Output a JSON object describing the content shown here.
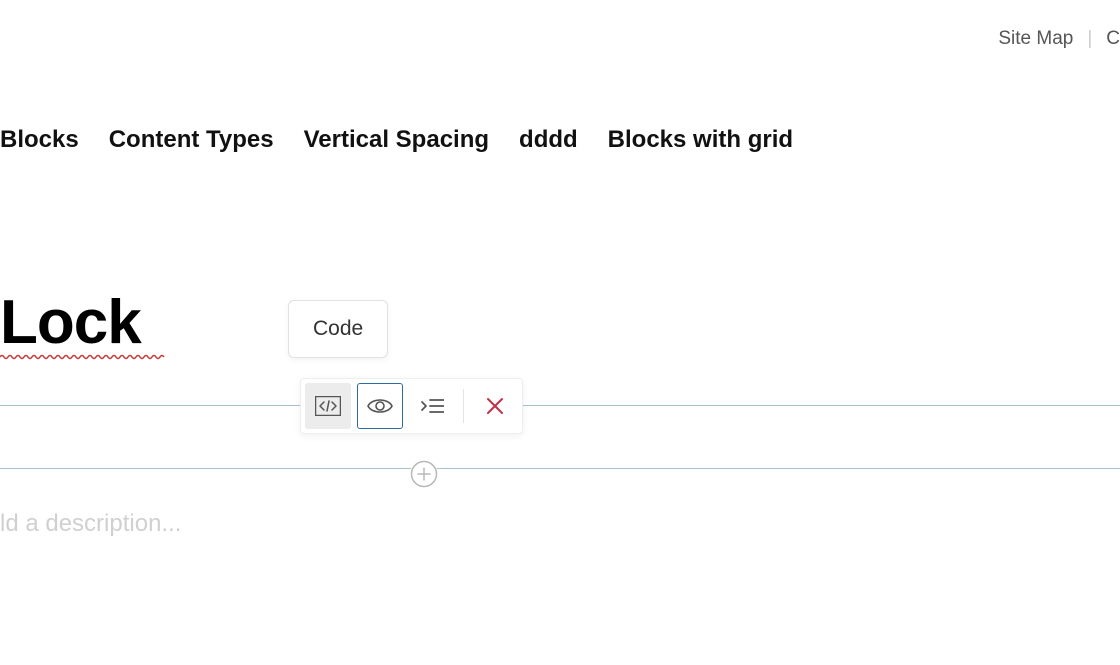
{
  "topLinks": {
    "siteMap": "Site Map",
    "cPartial": "C"
  },
  "nav": {
    "items": [
      "Blocks",
      "Content Types",
      "Vertical Spacing",
      "dddd",
      "Blocks with grid"
    ]
  },
  "title": "Lock",
  "tooltip": "Code",
  "toolbar": {
    "icons": {
      "code": "code-icon",
      "preview": "eye-icon",
      "indent": "indent-icon",
      "close": "close-icon"
    }
  },
  "description": {
    "placeholder": "ld a description...",
    "value": ""
  },
  "colors": {
    "lineBlue": "#a7c3d1",
    "closeRed": "#c0334a",
    "selectBlue": "#2e6ca0",
    "spellRed": "#c73a3a"
  }
}
